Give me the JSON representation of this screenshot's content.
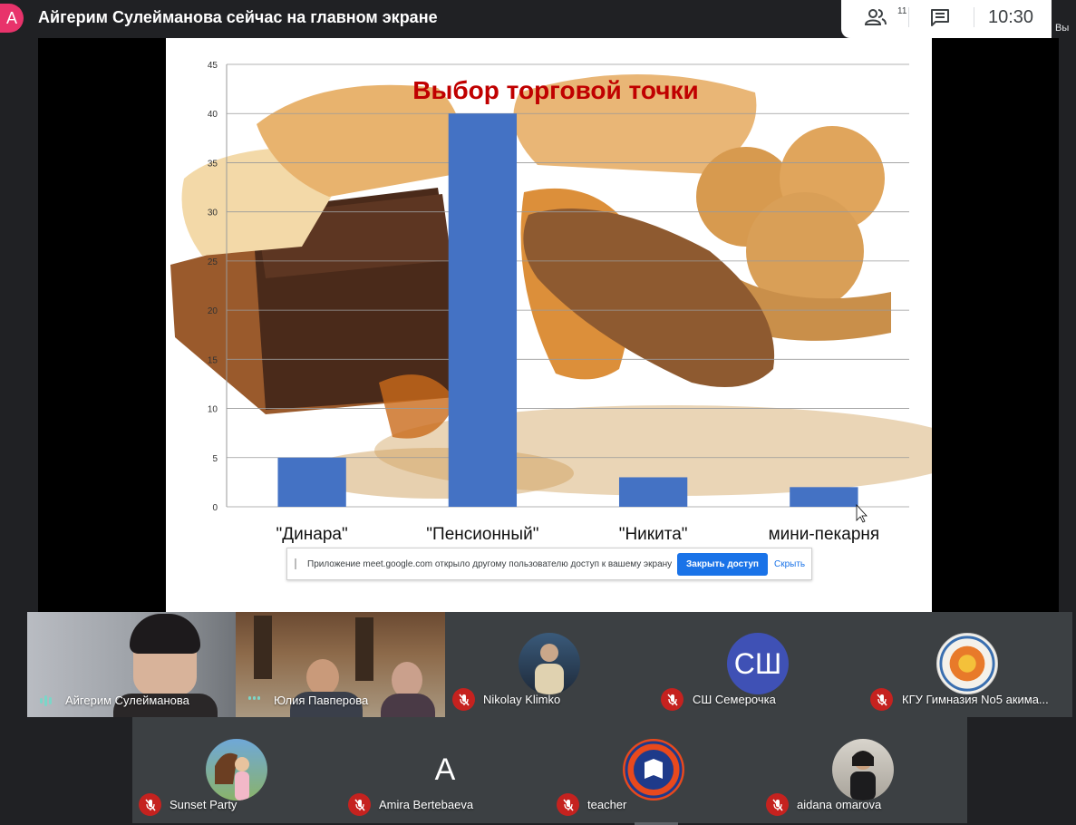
{
  "header": {
    "presenter_initial": "A",
    "title": "Айгерим Сулейманова сейчас на главном экране",
    "participants_count": "11",
    "clock": "10:30",
    "you_label": "Вы"
  },
  "slide": {
    "chart_data": {
      "type": "bar",
      "title": "Выбор торговой точки",
      "categories": [
        "\"Динара\"",
        "\"Пенсионный\"",
        "\"Никита\"",
        "мини-пекарня"
      ],
      "values": [
        5,
        40,
        3,
        2
      ],
      "ylim": [
        0,
        45
      ],
      "yticks": [
        0,
        5,
        10,
        15,
        20,
        25,
        30,
        35,
        40,
        45
      ],
      "grid": true,
      "bar_color": "#4472c4",
      "title_color": "#c00000"
    }
  },
  "share_bar": {
    "message": "Приложение meet.google.com открыло другому пользователю доступ к вашему экрану",
    "stop_label": "Закрыть доступ",
    "hide_label": "Скрыть"
  },
  "participants": [
    {
      "name": "Айгерим Сулейманова",
      "kind": "video",
      "speaking": true
    },
    {
      "name": "Юлия Павперова",
      "kind": "video",
      "speaking": true
    },
    {
      "name": "Nikolay Klimko",
      "kind": "photo",
      "muted": true
    },
    {
      "name": "СШ Семерочка",
      "kind": "initials",
      "initials": "СШ",
      "color": "#3f51b5",
      "muted": true
    },
    {
      "name": "КГУ Гимназия No5 акима...",
      "kind": "logo",
      "muted": true
    },
    {
      "name": "Sunset Party",
      "kind": "photo",
      "muted": true
    },
    {
      "name": "Amira Bertebaeva",
      "kind": "initials",
      "initials": "A",
      "color": "#e8491d",
      "muted": true
    },
    {
      "name": "teacher",
      "kind": "logo",
      "muted": true
    },
    {
      "name": "aidana omarova",
      "kind": "photo",
      "muted": true
    }
  ]
}
